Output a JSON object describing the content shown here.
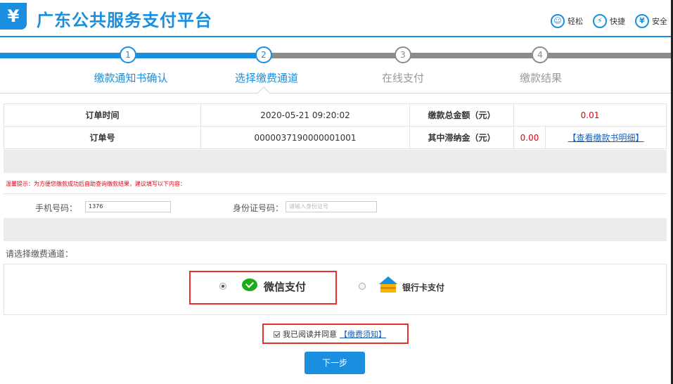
{
  "header": {
    "logo": "¥",
    "title": "广东公共服务支付平台",
    "badges": [
      {
        "icon": "smile-icon",
        "glyph": "☺",
        "label": "轻松"
      },
      {
        "icon": "lightning-icon",
        "glyph": "⚡",
        "label": "快捷"
      },
      {
        "icon": "shield-icon",
        "glyph": "¥",
        "label": "安全"
      }
    ]
  },
  "steps": [
    {
      "num": "1",
      "label": "缴款通知书确认"
    },
    {
      "num": "2",
      "label": "选择缴费通道"
    },
    {
      "num": "3",
      "label": "在线支付"
    },
    {
      "num": "4",
      "label": "缴款结果"
    }
  ],
  "order": {
    "time_label": "订单时间",
    "time_value": "2020-05-21 09:20:02",
    "total_label": "缴款总金额（元）",
    "total_value": "0.01",
    "id_label": "订单号",
    "id_value": "0000037190000001001",
    "late_fee_label": "其中滞纳金（元）",
    "late_fee_value": "0.00",
    "detail_link": "【查看缴款书明细】"
  },
  "tip": "温馨提示：为方便您缴款成功后自助查询缴款结果，建议填写以下内容：",
  "form": {
    "phone_label": "手机号码：",
    "phone_value": "1376",
    "id_label": "身份证号码：",
    "id_placeholder": "请输入身份证号"
  },
  "channel": {
    "title": "请选择缴费通道：",
    "wechat_label": "微信支付",
    "bank_label": "银行卡支付"
  },
  "agree": {
    "text": "我已阅读并同意",
    "link": "【缴费须知】"
  },
  "next_button": "下一步",
  "colors": {
    "primary": "#1a8fe0",
    "alert": "#e60012",
    "highlight_border": "#e3322b",
    "wechat": "#1aad19"
  }
}
